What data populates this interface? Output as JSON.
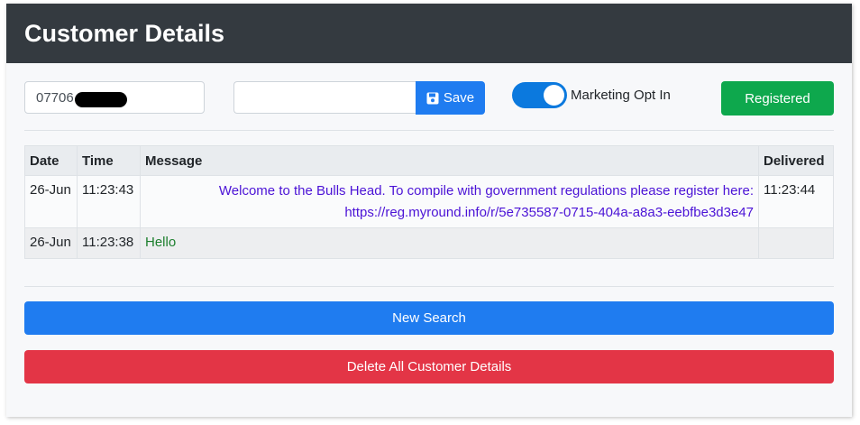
{
  "header": {
    "title": "Customer Details"
  },
  "form": {
    "phone_value": "07706",
    "name_value": "",
    "save_label": "Save",
    "marketing_label": "Marketing Opt In",
    "marketing_on": true,
    "registered_label": "Registered"
  },
  "table": {
    "headers": [
      "Date",
      "Time",
      "Message",
      "Delivered"
    ],
    "rows": [
      {
        "date": "26-Jun",
        "time": "11:23:43",
        "message_line1": "Welcome to the Bulls Head. To compile with government regulations please register here:",
        "message_line2": "https://reg.myround.info/r/5e735587-0715-404a-a8a3-eebfbe3d3e47",
        "delivered": "11:23:44"
      },
      {
        "date": "26-Jun",
        "time": "11:23:38",
        "message": "Hello",
        "delivered": ""
      }
    ]
  },
  "actions": {
    "new_search_label": "New Search",
    "delete_all_label": "Delete All Customer Details"
  },
  "colors": {
    "header_bg": "#343a40",
    "primary": "#1f7cf0",
    "success": "#0ea84d",
    "danger": "#e33546",
    "outgoing_message": "#4b13d6",
    "incoming_message": "#1d7f2e"
  }
}
